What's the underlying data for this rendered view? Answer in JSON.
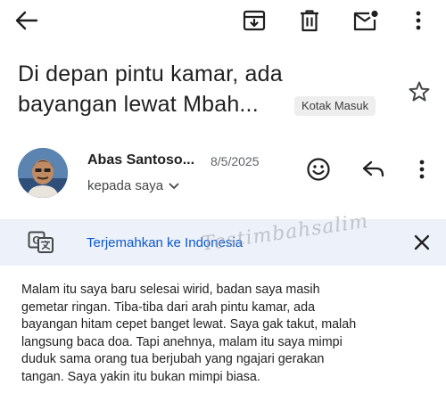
{
  "toolbar": {
    "back_icon": "arrow-back-icon",
    "archive_icon": "archive-icon",
    "delete_icon": "trash-icon",
    "mark_unread_icon": "mail-unread-icon",
    "more_icon": "more-vert-icon"
  },
  "email": {
    "subject_line1": "Di depan pintu kamar, ada",
    "subject_line2": "bayangan lewat Mbah...",
    "label": "Kotak Masuk",
    "star_icon": "star-outline-icon",
    "sender_name": "Abas Santoso...",
    "date": "8/5/2025",
    "recipient": "kepada saya",
    "body_lines": [
      "Malam itu saya baru selesai wirid, badan saya masih",
      "gemetar ringan. Tiba-tiba dari arah pintu kamar, ada",
      "bayangan hitam cepet banget lewat. Saya gak takut, malah",
      "langsung baca doa. Tapi anehnya, malam itu saya mimpi",
      "duduk sama orang tua berjubah yang ngajari gerakan",
      "tangan. Saya yakin itu bukan mimpi biasa."
    ]
  },
  "translate": {
    "link_text": "Terjemahkan ke Indonesia",
    "icon": "translate-icon",
    "close_icon": "close-icon"
  },
  "watermark": "Testimbahsalim",
  "colors": {
    "translate_bar_bg": "#edf2fa",
    "link_blue": "#0b57d0",
    "text": "#1f1f1f"
  }
}
